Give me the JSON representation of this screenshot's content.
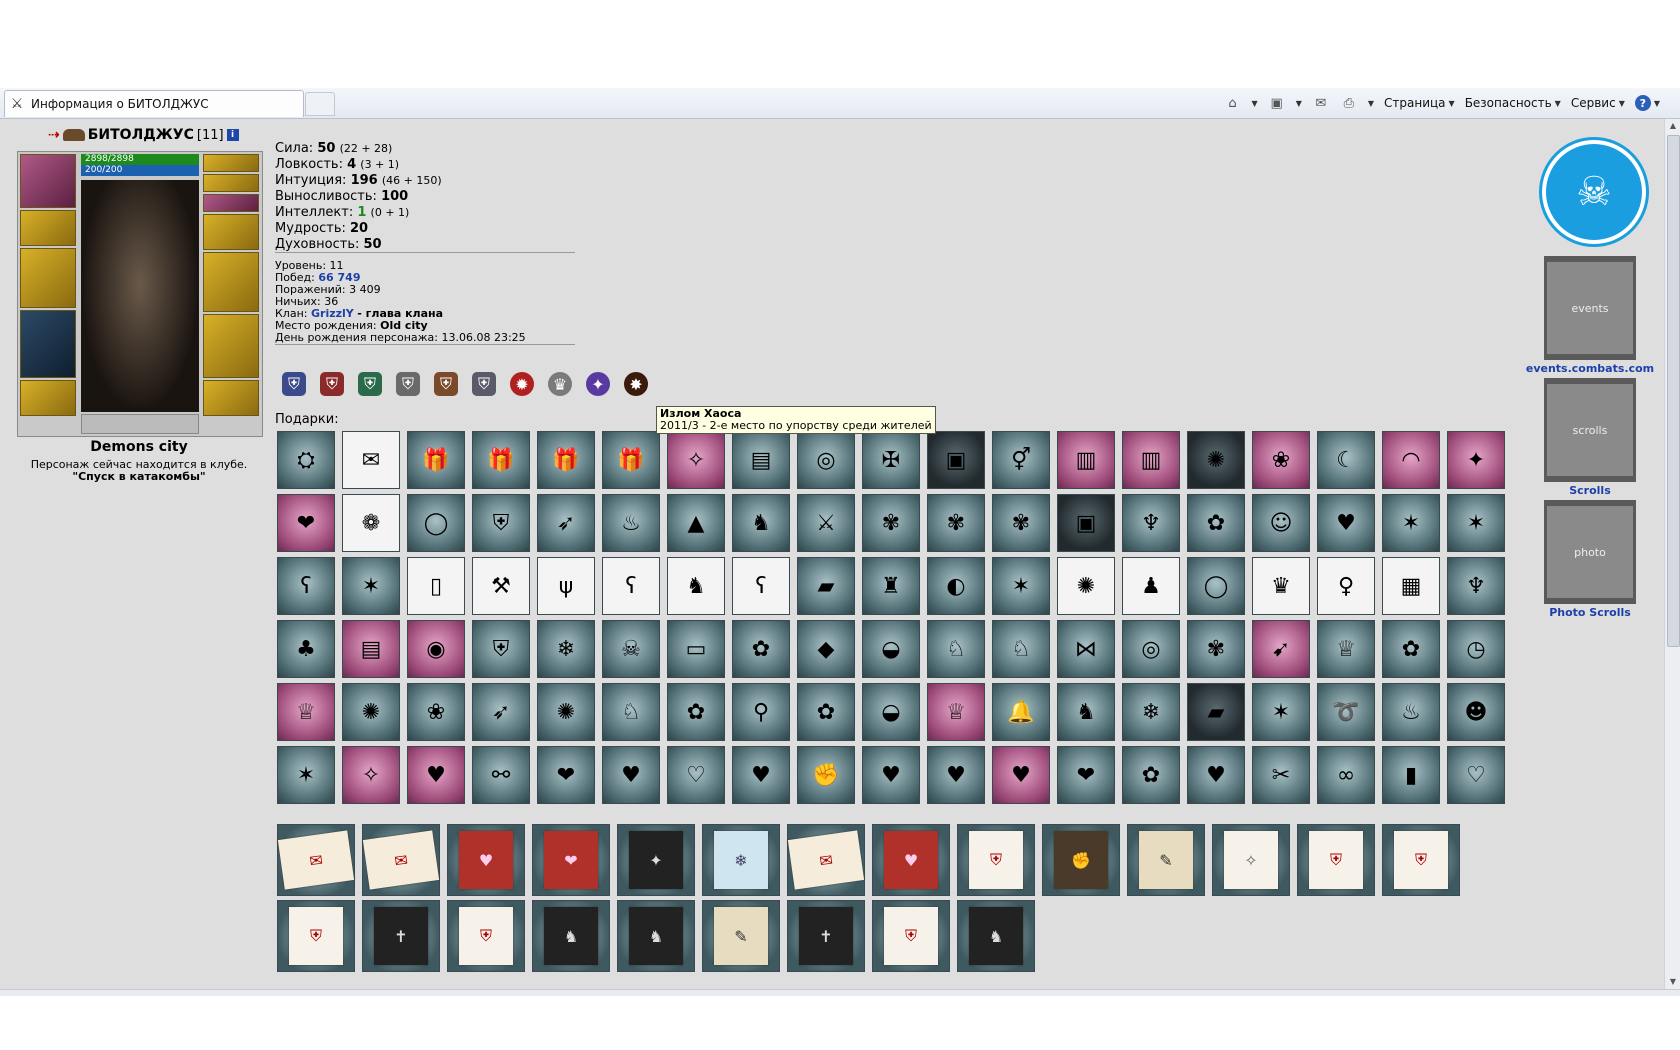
{
  "browser": {
    "tab_title": "Информация о БИТОЛДЖУС",
    "commands": {
      "page": "Страница",
      "security": "Безопасность",
      "service": "Сервис"
    }
  },
  "character": {
    "nick": "БИТОЛДЖУС",
    "level": "[11]",
    "hp": "2898/2898",
    "mana": "200/200",
    "city": "Demons city",
    "location_text": "Персонаж сейчас находится в клубе.",
    "location_place": "\"Спуск в катакомбы\""
  },
  "stats": [
    {
      "label": "Сила:",
      "value": "50",
      "extra": "(22 + 28)"
    },
    {
      "label": "Ловкость:",
      "value": "4",
      "extra": "(3 + 1)"
    },
    {
      "label": "Интуиция:",
      "value": "196",
      "extra": "(46 + 150)"
    },
    {
      "label": "Выносливость:",
      "value": "100",
      "extra": ""
    },
    {
      "label": "Интеллект:",
      "value": "1",
      "extra": "(0 + 1)"
    },
    {
      "label": "Мудрость:",
      "value": "20",
      "extra": ""
    },
    {
      "label": "Духовность:",
      "value": "50",
      "extra": ""
    }
  ],
  "info": {
    "level_label": "Уровень:",
    "level": "11",
    "wins_label": "Побед:",
    "wins": "66 749",
    "losses_label": "Поражений:",
    "losses": "3 409",
    "draws_label": "Ничьих:",
    "draws": "36",
    "clan_label": "Клан:",
    "clan": "GrizzlY",
    "clan_role": "- глава клана",
    "birthplace_label": "Место рождения:",
    "birthplace": "Old city",
    "birthday_label": "День рождения персонажа:",
    "birthday": "13.06.08 23:25"
  },
  "gifts_label": "Подарки:",
  "tooltip": {
    "title": "Излом Хаоса",
    "text": "2011/3 - 2-е место по упорству среди жителей"
  },
  "colors": {
    "background": "#dedede",
    "link": "#1d3fa8",
    "accent_blue": "#1a9ee0"
  },
  "sidebar_links": {
    "events": "events.combats.com",
    "scrolls": "Scrolls",
    "photo_scrolls": "Photo Scrolls"
  },
  "scroll_banners": {
    "events": "events",
    "scrolls": "scrolls",
    "photo": "photo"
  }
}
